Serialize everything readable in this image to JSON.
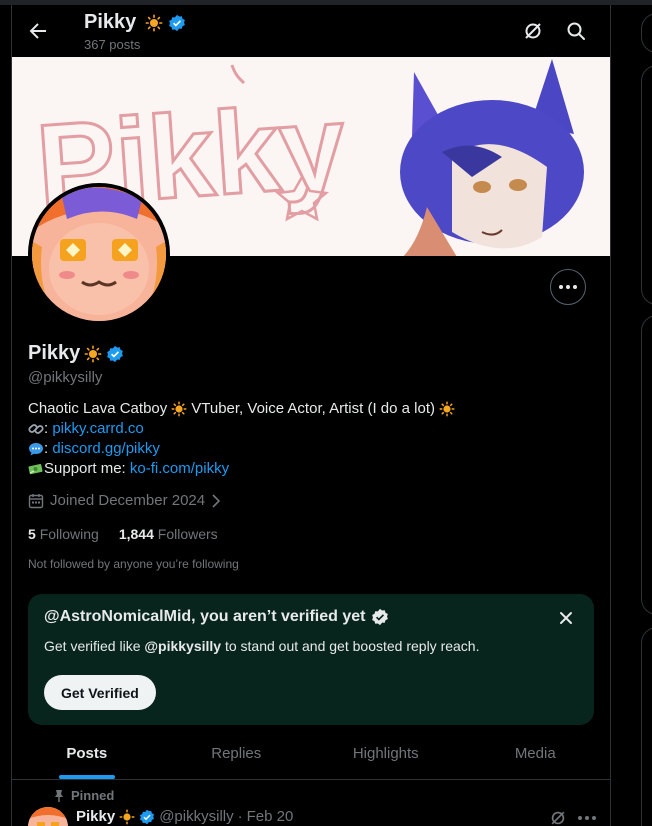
{
  "header": {
    "name": "Pikky",
    "posts_count": "367 posts"
  },
  "profile": {
    "name": "Pikky",
    "handle": "@pikkysilly",
    "bio_line1": "Chaotic Lava Catboy",
    "bio_line1b": "VTuber, Voice Actor, Artist (I do a lot)",
    "link1_prefix": ": ",
    "link1": "pikky.carrd.co",
    "link2_prefix": ": ",
    "link2": "discord.gg/pikky",
    "support_label": "Support me: ",
    "link3": "ko-fi.com/pikky",
    "joined": "Joined December 2024",
    "following_count": "5",
    "following_label": "Following",
    "followers_count": "1,844",
    "followers_label": "Followers",
    "not_followed": "Not followed by anyone you’re following"
  },
  "promo": {
    "title": "@AstroNomicalMid, you aren’t verified yet",
    "text_before": "Get verified like ",
    "text_handle": "@pikkysilly",
    "text_after": " to stand out and get boosted reply reach.",
    "button": "Get Verified"
  },
  "tabs": [
    {
      "label": "Posts",
      "active": true
    },
    {
      "label": "Replies",
      "active": false
    },
    {
      "label": "Highlights",
      "active": false
    },
    {
      "label": "Media",
      "active": false
    }
  ],
  "pinned_post": {
    "pinned_label": "Pinned",
    "name": "Pikky",
    "handle": "@pikkysilly",
    "separator": "·",
    "date": "Feb 20"
  },
  "banner_text": "Pikky",
  "colors": {
    "accent": "#1d9bf0",
    "promo_bg": "#07251c",
    "text": "#e7e9ea",
    "muted": "#71767b"
  },
  "icons": [
    "back-arrow-icon",
    "grok-icon",
    "search-icon",
    "more-icon",
    "calendar-icon",
    "chevron-right-icon",
    "close-icon",
    "pin-icon",
    "verified-badge-icon",
    "sun-emoji-icon",
    "link-emoji-icon",
    "speech-bubble-emoji-icon",
    "money-emoji-icon"
  ]
}
